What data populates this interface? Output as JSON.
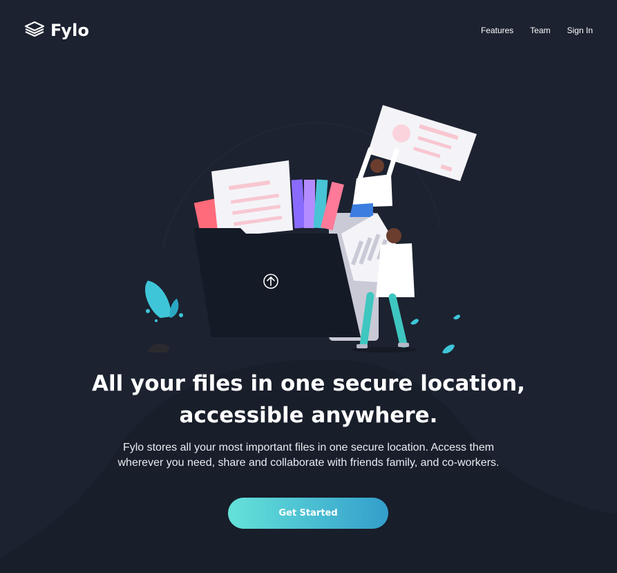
{
  "brand": {
    "name": "Fylo",
    "logo_icon": "layers-icon"
  },
  "nav": {
    "items": [
      {
        "label": "Features"
      },
      {
        "label": "Team"
      },
      {
        "label": "Sign In"
      }
    ]
  },
  "hero": {
    "title_line1": "All your files in one secure location,",
    "title_line2": "accessible anywhere.",
    "description": "Fylo stores all your most important files in one secure location. Access them wherever you need, share and collaborate with friends family, and co-workers.",
    "cta_label": "Get Started",
    "illustration": "file-sharing-illustration",
    "folder_icon": "upload-arrow-icon"
  },
  "colors": {
    "background": "#1c2230",
    "background_curve": "#181e2a",
    "cta_gradient_start": "#65e2d9",
    "cta_gradient_end": "#339ecc",
    "text": "#ffffff"
  }
}
